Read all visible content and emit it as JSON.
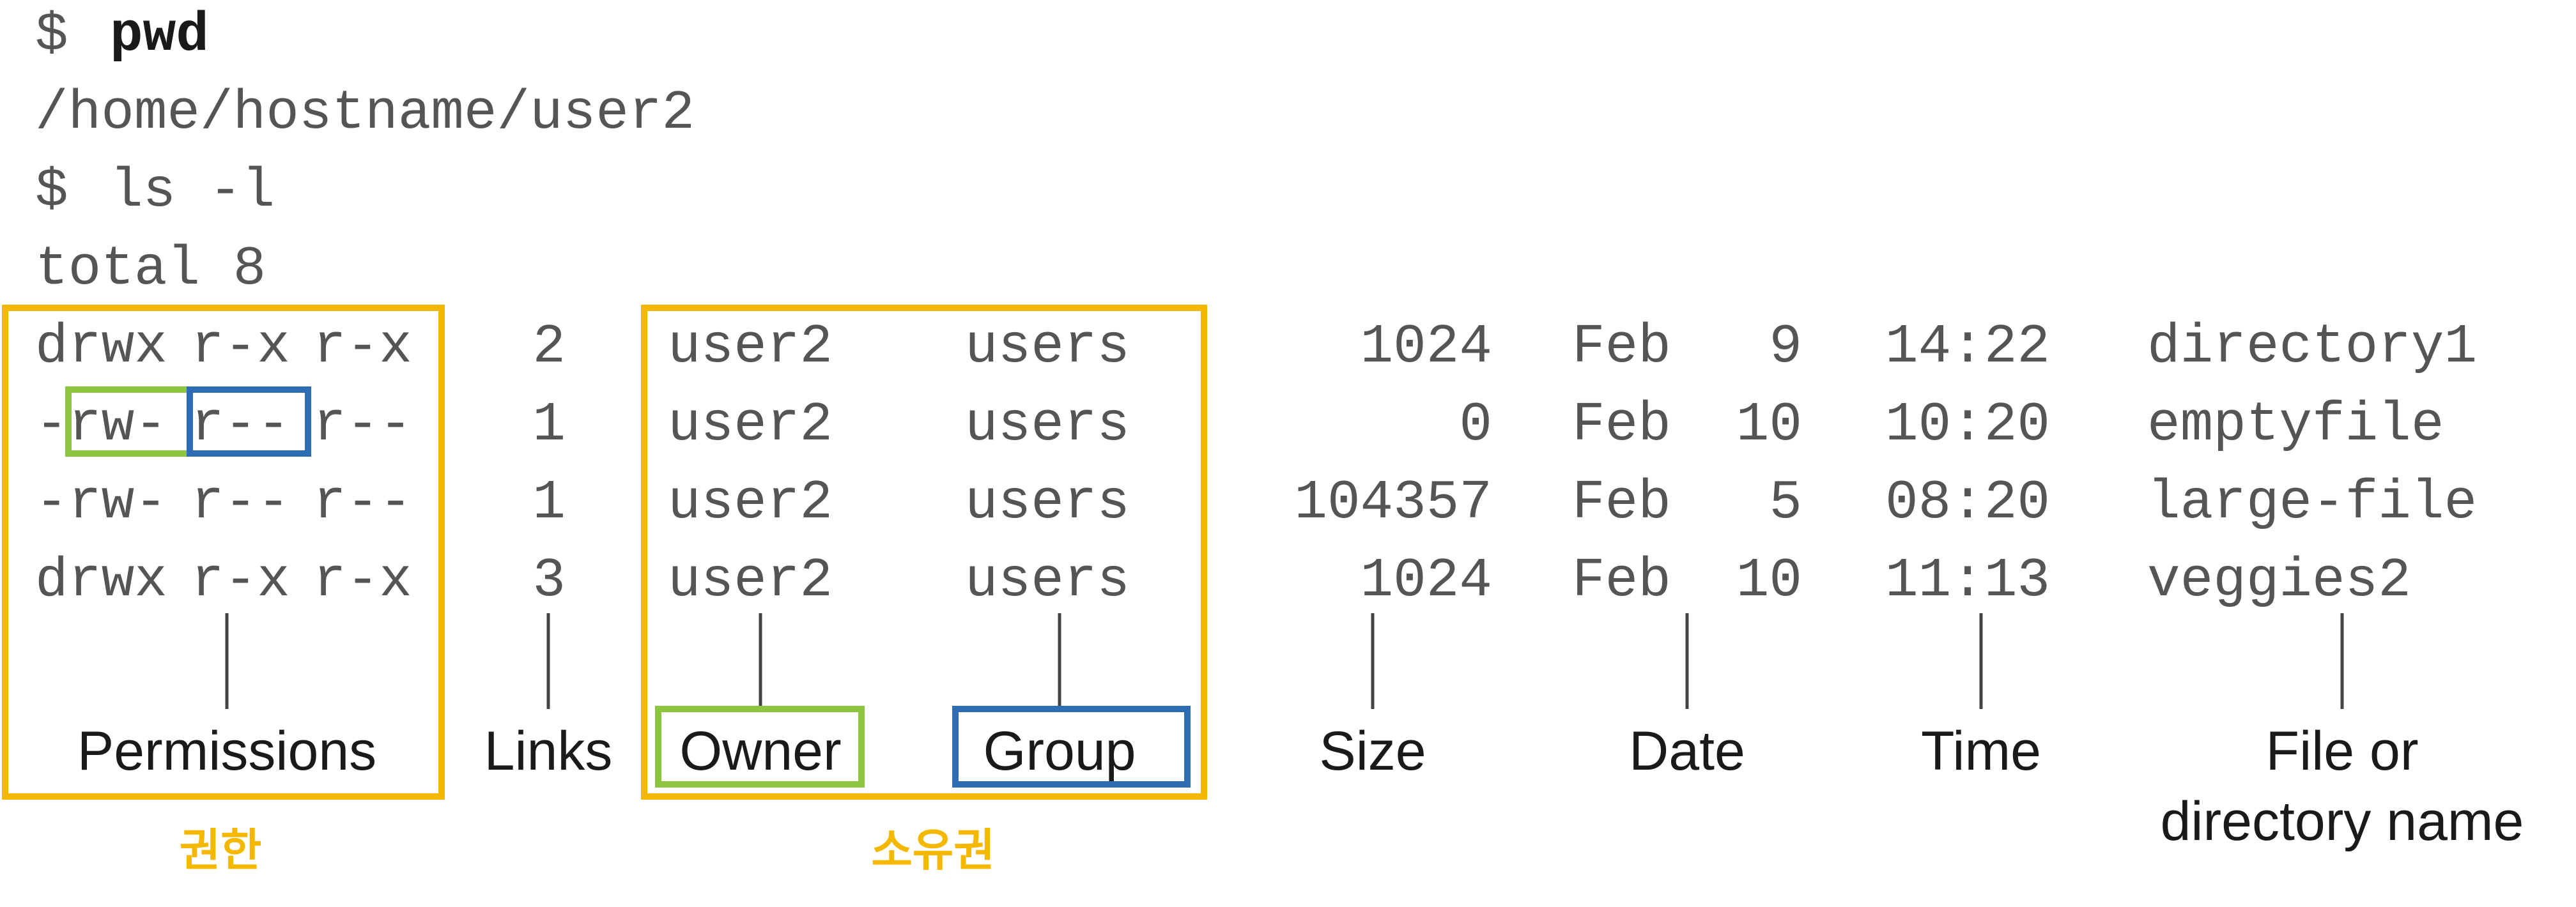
{
  "terminal": {
    "prompt": "$",
    "cmd_pwd": "pwd",
    "pwd_output": "/home/hostname/user2",
    "cmd_ls": "ls -l",
    "total": "total 8",
    "rows": [
      {
        "perm_type": "d",
        "perm_owner": "rwx",
        "perm_group": "r-x",
        "perm_other": "r-x",
        "links": "2",
        "owner": "user2",
        "group": "users",
        "size": "1024",
        "month": "Feb",
        "day": "9",
        "time": "14:22",
        "name": "directory1"
      },
      {
        "perm_type": "-",
        "perm_owner": "rw-",
        "perm_group": "r--",
        "perm_other": "r--",
        "links": "1",
        "owner": "user2",
        "group": "users",
        "size": "0",
        "month": "Feb",
        "day": "10",
        "time": "10:20",
        "name": "emptyfile"
      },
      {
        "perm_type": "-",
        "perm_owner": "rw-",
        "perm_group": "r--",
        "perm_other": "r--",
        "links": "1",
        "owner": "user2",
        "group": "users",
        "size": "104357",
        "month": "Feb",
        "day": "5",
        "time": "08:20",
        "name": "large-file"
      },
      {
        "perm_type": "d",
        "perm_owner": "rwx",
        "perm_group": "r-x",
        "perm_other": "r-x",
        "links": "3",
        "owner": "user2",
        "group": "users",
        "size": "1024",
        "month": "Feb",
        "day": "10",
        "time": "11:13",
        "name": "veggies2"
      }
    ]
  },
  "labels": {
    "permissions": "Permissions",
    "links": "Links",
    "owner": "Owner",
    "group": "Group",
    "size": "Size",
    "date": "Date",
    "time": "Time",
    "name_line1": "File or",
    "name_line2": "directory name"
  },
  "annotations": {
    "permissions_kr": "권한",
    "ownership_kr": "소유권"
  },
  "colors": {
    "yellow": "#F5B800",
    "green": "#8CC63F",
    "blue": "#2E6DB4"
  }
}
